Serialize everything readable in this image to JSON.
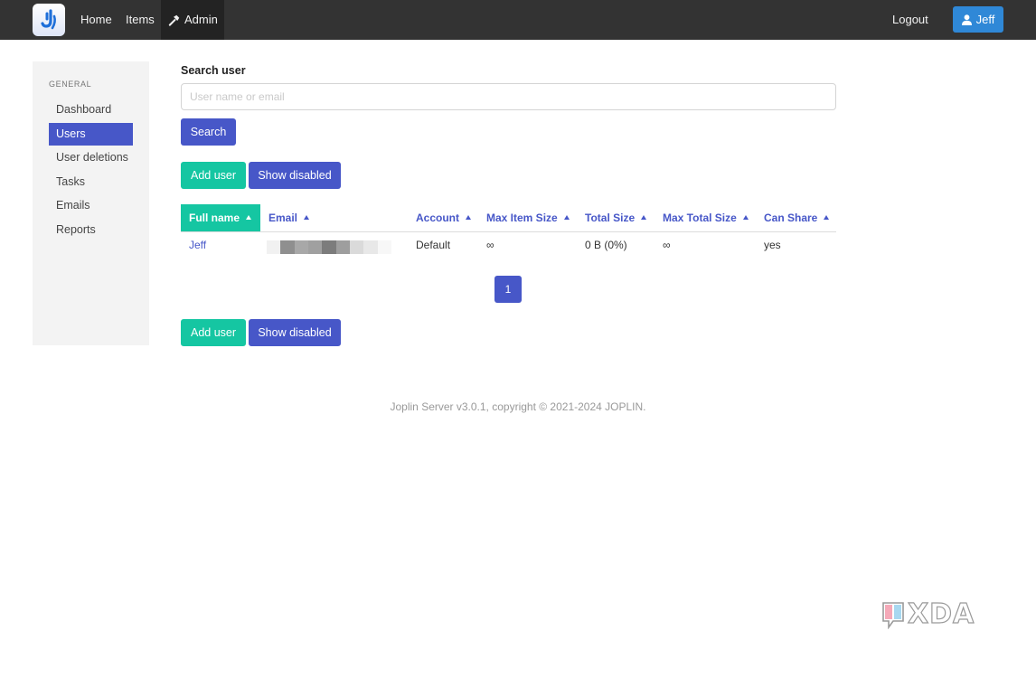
{
  "app": {
    "logo_icon": "joplin-logo-icon",
    "colors": {
      "primary": "#4757c8",
      "teal": "#15c6a2",
      "user_button": "#2f88d7",
      "topbar": "#333333"
    }
  },
  "nav": {
    "home": "Home",
    "items": "Items",
    "admin": "Admin",
    "logout": "Logout",
    "user": "Jeff"
  },
  "sidebar": {
    "heading": "GENERAL",
    "items": [
      {
        "label": "Dashboard"
      },
      {
        "label": "Users",
        "active": true
      },
      {
        "label": "User deletions"
      },
      {
        "label": "Tasks"
      },
      {
        "label": "Emails"
      },
      {
        "label": "Reports"
      }
    ]
  },
  "search": {
    "label": "Search user",
    "placeholder": "User name or email",
    "value": "",
    "button": "Search"
  },
  "actions": {
    "add_user": "Add user",
    "show_disabled": "Show disabled"
  },
  "table": {
    "headers": [
      "Full name",
      "Email",
      "Account",
      "Max Item Size",
      "Total Size",
      "Max Total Size",
      "Can Share"
    ],
    "sorted_column": "Full name",
    "rows": [
      {
        "full_name": "Jeff",
        "email": "",
        "account": "Default",
        "max_item_size": "∞",
        "total_size": "0 B (0%)",
        "max_total_size": "∞",
        "can_share": "yes"
      }
    ]
  },
  "pagination": {
    "current": "1"
  },
  "footer": {
    "text": "Joplin Server v3.0.1, copyright © 2021-2024 JOPLIN."
  },
  "watermark": {
    "text": "XDA"
  }
}
